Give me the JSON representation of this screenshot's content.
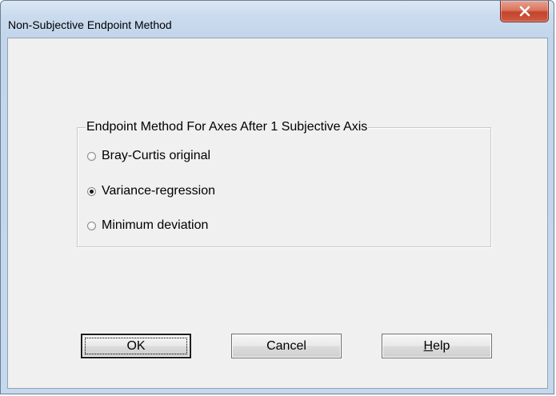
{
  "window": {
    "title": "Non-Subjective Endpoint Method",
    "close_icon": "close-icon"
  },
  "group": {
    "legend": "Endpoint Method For Axes After 1 Subjective Axis",
    "options": [
      {
        "label": "Bray-Curtis original",
        "checked": false
      },
      {
        "label": "Variance-regression",
        "checked": true
      },
      {
        "label": "Minimum deviation",
        "checked": false
      }
    ]
  },
  "buttons": {
    "ok_label": "OK",
    "cancel_label": "Cancel",
    "help_label": "Help"
  }
}
